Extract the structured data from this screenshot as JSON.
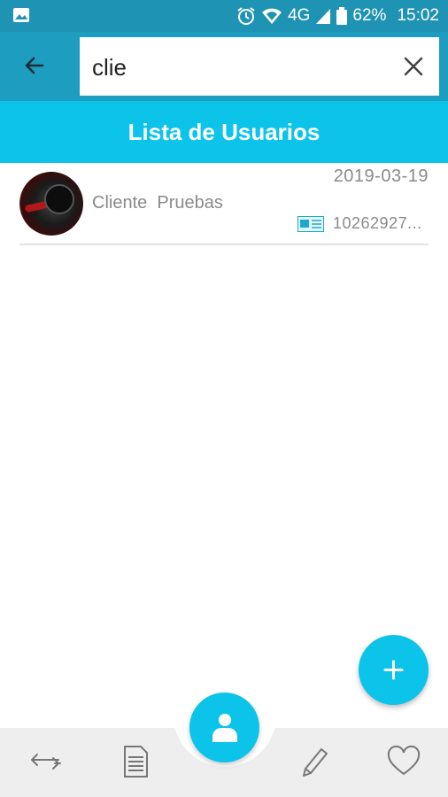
{
  "status_bar": {
    "network": "4G",
    "battery": "62%",
    "time": "15:02",
    "icons": [
      "image-icon",
      "alarm-icon",
      "wifi-icon",
      "signal-icon",
      "battery-icon"
    ]
  },
  "toolbar": {
    "back_icon": "arrow-left-icon",
    "search_value": "clie",
    "clear_icon": "close-icon"
  },
  "banner": {
    "title": "Lista de Usuarios"
  },
  "users": [
    {
      "name": "Cliente  Pruebas",
      "date": "2019-03-19",
      "id": "10262927..."
    }
  ],
  "fab": {
    "icon": "plus-icon"
  },
  "bottom_nav": {
    "items": [
      "swap-arrows-icon",
      "document-icon",
      "person-icon",
      "pencil-icon",
      "heart-icon"
    ]
  },
  "colors": {
    "status_bar": "#1f93b3",
    "toolbar": "#1d9dbf",
    "accent": "#0cc3ea",
    "nav_background": "#eeeeee",
    "text_muted": "#8a8a8a"
  }
}
